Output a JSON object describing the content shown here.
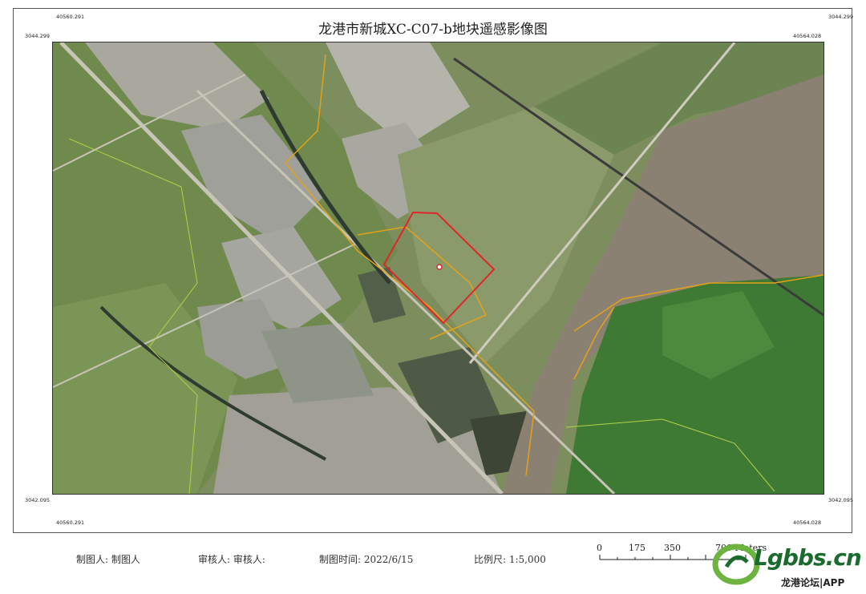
{
  "map": {
    "title": "龙港市新城XC-C07-b地块遥感影像图",
    "coords": {
      "top_left_x": "40560.291",
      "top_right_x": "40564.028",
      "bottom_left_x": "40560.291",
      "bottom_right_x": "40564.028",
      "left_top_y": "3044.299",
      "right_top_y": "3044.299",
      "left_bottom_y": "3042.095",
      "right_bottom_y": "3042.095"
    },
    "colors": {
      "parcel_outline": "#e0262b",
      "boundary_lines": "#e2a21a",
      "water": "#8b8172",
      "vegetation": "#4f8a3a"
    }
  },
  "footer": {
    "maker": "制图人: 制图人",
    "reviewer": "审核人: 审核人:",
    "date": "制图时间: 2022/6/15",
    "scale": "比例尺: 1:5,000"
  },
  "scalebar": {
    "labels": [
      "0",
      "175",
      "350",
      "700 Meters"
    ]
  },
  "logo": {
    "brand": "Lgbbs.cn",
    "subtitle": "龙港论坛|APP"
  }
}
